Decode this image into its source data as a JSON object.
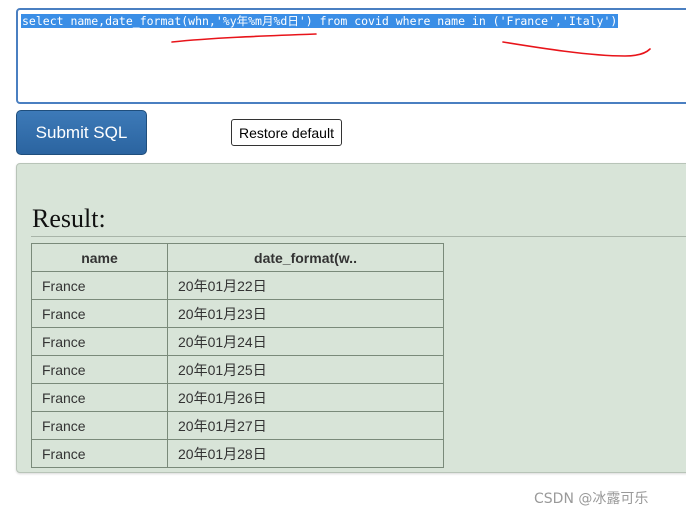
{
  "editor": {
    "sql": "select name,date_format(whn,'%y年%m月%d日') from covid where name in ('France','Italy')"
  },
  "buttons": {
    "submit_label": "Submit SQL",
    "restore_label": "Restore default"
  },
  "result": {
    "title": "Result:",
    "columns": [
      "name",
      "date_format(w.."
    ],
    "rows": [
      [
        "France",
        "20年01月22日"
      ],
      [
        "France",
        "20年01月23日"
      ],
      [
        "France",
        "20年01月24日"
      ],
      [
        "France",
        "20年01月25日"
      ],
      [
        "France",
        "20年01月26日"
      ],
      [
        "France",
        "20年01月27日"
      ],
      [
        "France",
        "20年01月28日"
      ]
    ]
  },
  "annotation": {
    "color": "#e8141a"
  },
  "watermark": {
    "text": "CSDN @冰露可乐"
  },
  "colors": {
    "selection": "#3a8ee6",
    "button_blue": "#2b64a0",
    "panel_bg": "#d8e4d8"
  }
}
